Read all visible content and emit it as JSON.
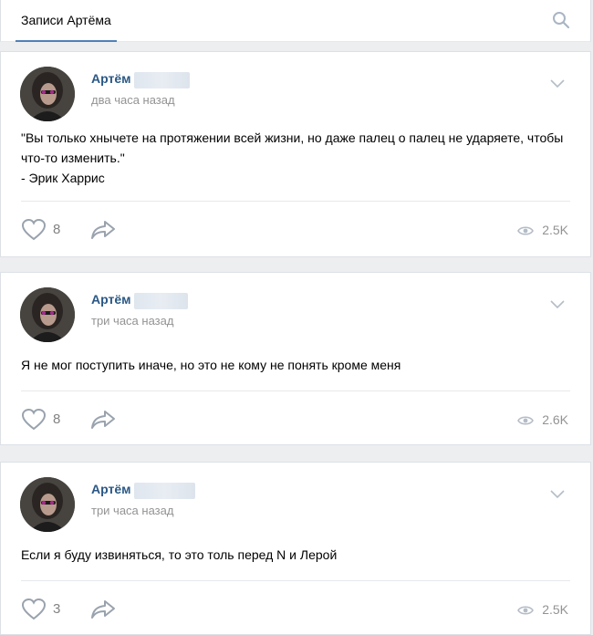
{
  "header": {
    "tab_label": "Записи Артёма"
  },
  "posts": [
    {
      "author": "Артём",
      "time": "два часа назад",
      "text": "\"Вы только хнычете на протяжении всей жизни, но даже палец о палец не ударяете, чтобы что-то изменить.\"\n- Эрик Харрис",
      "likes": "8",
      "views": "2.5K"
    },
    {
      "author": "Артём",
      "time": "три часа назад",
      "text": "Я не мог поступить иначе, но это не кому не понять кроме меня",
      "likes": "8",
      "views": "2.6K"
    },
    {
      "author": "Артём",
      "time": "три часа назад",
      "text": "Если я буду извиняться, то это толь перед N и Лерой",
      "likes": "3",
      "views": "2.5K"
    }
  ],
  "colors": {
    "accent": "#5181b8",
    "author_link": "#2a5885",
    "muted": "#939393",
    "background": "#edeef0"
  },
  "icons": {
    "search": "search-icon",
    "menu": "chevron-down-icon",
    "like": "heart-icon",
    "share": "share-arrow-icon",
    "views": "eye-icon"
  }
}
